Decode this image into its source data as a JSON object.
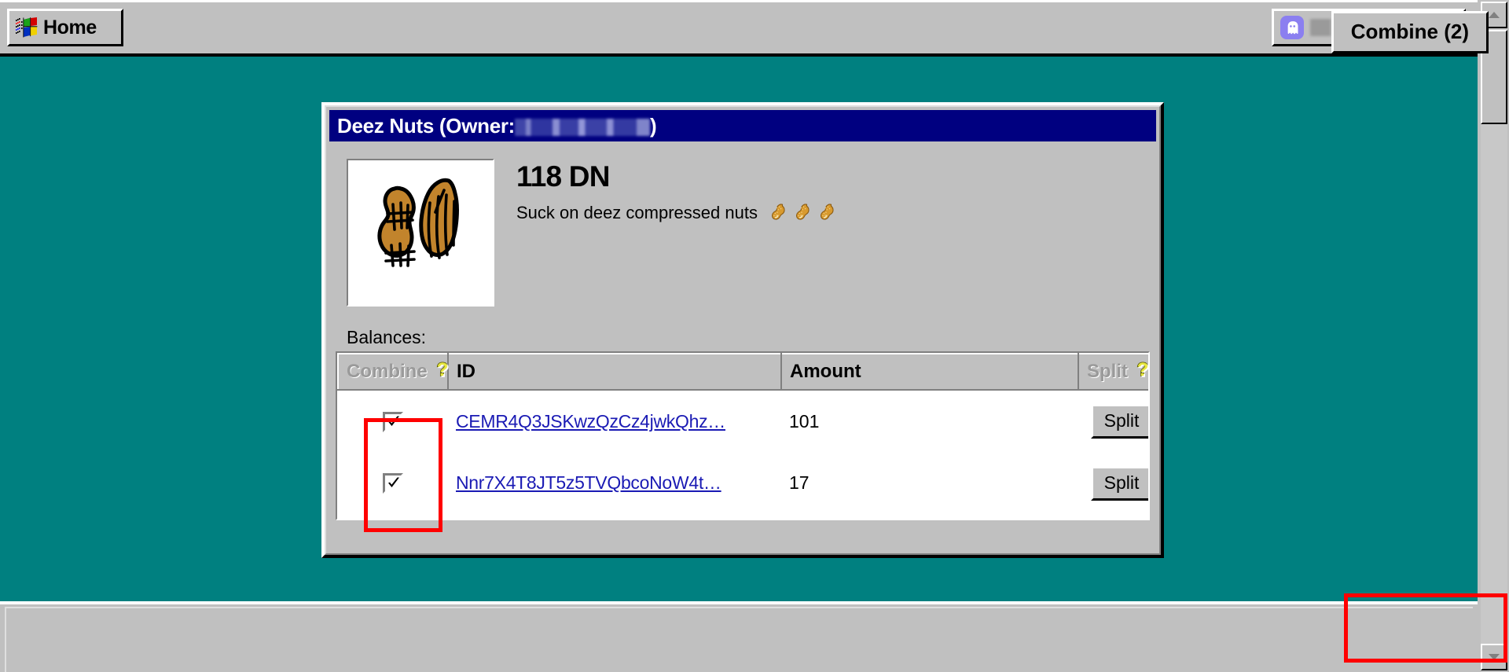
{
  "taskbar": {
    "home_button_label": "Home",
    "home_icon": "windows-flag-icon",
    "account_icon": "ghost-avatar-icon",
    "account_label_redacted": "",
    "account_label_note": "redacted"
  },
  "window": {
    "title_prefix": "Deez Nuts (Owner:",
    "title_suffix": ")",
    "owner_redacted": "",
    "token": {
      "image_alt": "peanuts-illustration",
      "name": "118 DN",
      "description": "Suck on deez compressed nuts",
      "description_emojis": [
        "peanut-icon",
        "peanut-icon",
        "peanut-icon"
      ]
    },
    "balances_label": "Balances:",
    "table": {
      "columns": [
        {
          "label": "Combine",
          "help_icon": "help-question-icon",
          "dimmed": true
        },
        {
          "label": "ID",
          "help_icon": null,
          "dimmed": false
        },
        {
          "label": "Amount",
          "help_icon": null,
          "dimmed": false
        },
        {
          "label": "Split",
          "help_icon": "help-question-icon",
          "dimmed": true
        }
      ],
      "rows": [
        {
          "checked": true,
          "id": "CEMR4Q3JSKwzQzCz4jwkQhz…",
          "amount": "101",
          "split_label": "Split"
        },
        {
          "checked": true,
          "id": "Nnr7X4T8JT5z5TVQbcoNoW4t…",
          "amount": "17",
          "split_label": "Split"
        }
      ]
    }
  },
  "bottom_bar": {
    "combine_button_label": "Combine (2)"
  },
  "scrollbar": {
    "up_icon": "arrow-up-icon",
    "down_icon": "arrow-down-icon"
  },
  "colors": {
    "desktop": "#008080",
    "chrome": "#c0c0c0",
    "titlebar": "#000080",
    "link": "#1a1ab4",
    "annotation": "#ff0000",
    "avatar": "#8b7ff0",
    "help_icon": "#e8e840"
  }
}
